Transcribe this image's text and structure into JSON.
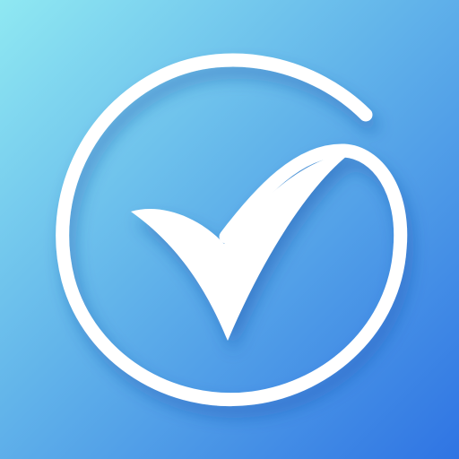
{
  "icon": {
    "semantic": "check-circle-icon",
    "colors": {
      "gradient_top_left": "#8fe8f2",
      "gradient_mid": "#62b4ea",
      "gradient_bottom_right": "#2f74e3",
      "mark": "#ffffff",
      "shadow": "#1a4fa8"
    }
  }
}
